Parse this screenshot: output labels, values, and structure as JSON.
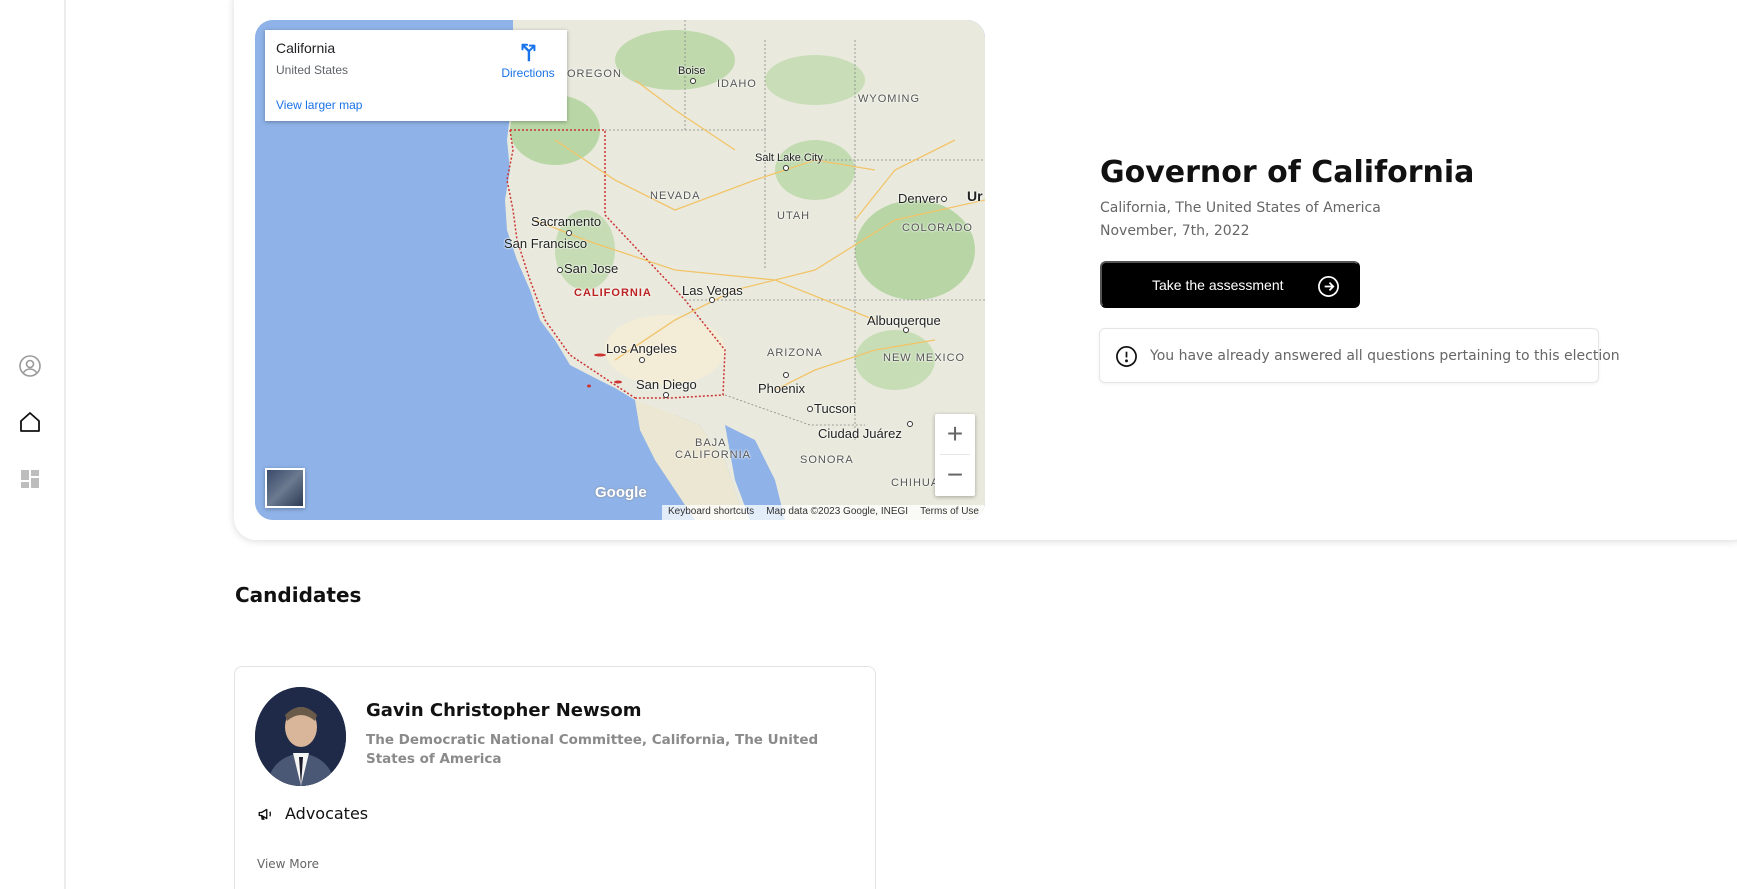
{
  "sidebar": {
    "icons": [
      "user-circle-icon",
      "home-icon",
      "dashboard-icon"
    ]
  },
  "map": {
    "info": {
      "title": "California",
      "subtitle": "United States",
      "directions_label": "Directions",
      "larger_map_label": "View larger map"
    },
    "labels": {
      "oregon": "OREGON",
      "boise": "Boise",
      "idaho": "IDAHO",
      "wyoming": "WYOMING",
      "salt_lake_city": "Salt Lake City",
      "nevada": "NEVADA",
      "utah": "UTAH",
      "denver": "Denver",
      "colorado": "COLORADO",
      "sacramento": "Sacramento",
      "san_francisco": "San Francisco",
      "san_jose": "San Jose",
      "california": "CALIFORNIA",
      "las_vegas": "Las Vegas",
      "albuquerque": "Albuquerque",
      "los_angeles": "Los Angeles",
      "arizona": "ARIZONA",
      "new_mexico": "NEW MEXICO",
      "san_diego": "San Diego",
      "phoenix": "Phoenix",
      "tucson": "Tucson",
      "ciudad_juarez": "Ciudad Juárez",
      "baja": "BAJA",
      "baja_california": "CALIFORNIA",
      "sonora": "SONORA",
      "chihua": "CHIHUA",
      "un": "Ur"
    },
    "zoom_in": "+",
    "zoom_out": "−",
    "google": "Google",
    "attribution": {
      "shortcuts": "Keyboard shortcuts",
      "data": "Map data ©2023 Google, INEGI",
      "terms": "Terms of Use"
    },
    "colors": {
      "water": "#8fb3e8",
      "land": "#e8eadf",
      "forest": "#b7d7a8",
      "border": "#cc3333"
    }
  },
  "election": {
    "title": "Governor of California",
    "location": "California, The United States of America",
    "date": "November, 7th, 2022",
    "assessment_button": "Take the assessment",
    "notice": "You have already answered all questions pertaining to this election"
  },
  "candidates": {
    "section_title": "Candidates",
    "items": [
      {
        "name": "Gavin Christopher Newsom",
        "affiliation": "The Democratic National Committee, California, The United States of America",
        "advocates_label": "Advocates",
        "view_more": "View More"
      }
    ]
  }
}
